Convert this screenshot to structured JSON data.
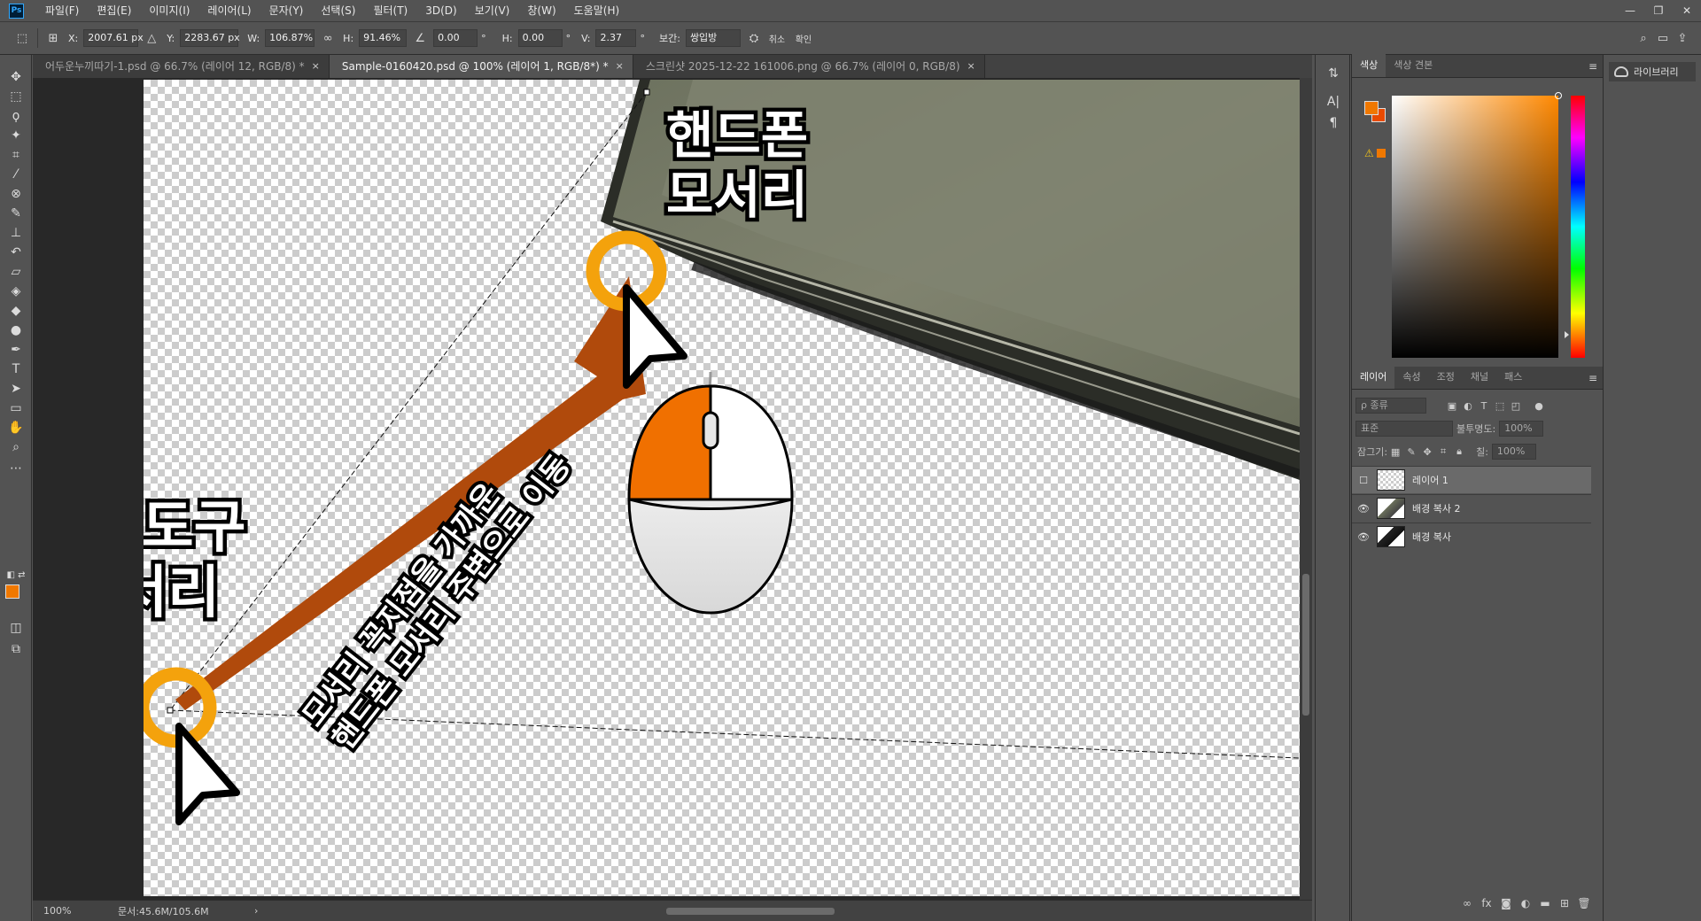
{
  "menu": {
    "items": [
      "파일(F)",
      "편집(E)",
      "이미지(I)",
      "레이어(L)",
      "문자(Y)",
      "선택(S)",
      "필터(T)",
      "3D(D)",
      "보기(V)",
      "창(W)",
      "도움말(H)"
    ],
    "window_controls": [
      "—",
      "❐",
      "✕"
    ]
  },
  "options": {
    "x_label": "X:",
    "x_value": "2007.61 px",
    "y_label": "Y:",
    "y_value": "2283.67 px",
    "w_label": "W:",
    "w_value": "106.87%",
    "h_label": "H:",
    "h_value": "91.46%",
    "angle_value": "0.00",
    "angle_unit": "°",
    "hskew_label": "H:",
    "hskew_value": "0.00",
    "vskew_label": "V:",
    "vskew_value": "2.37",
    "interp_label": "보간:",
    "interp_value": "쌍입방",
    "cancel_label": "취소",
    "commit_label": "확인"
  },
  "tabs": [
    {
      "label": "어두운누끼따기-1.psd @ 66.7% (레이어 12, RGB/8) *",
      "active": false
    },
    {
      "label": "Sample-0160420.psd @ 100% (레이어 1, RGB/8*) *",
      "active": true
    },
    {
      "label": "스크린샷 2025-12-22 161006.png @ 66.7% (레이어 0, RGB/8)",
      "active": false
    }
  ],
  "tab_close": "×",
  "canvas": {
    "label_phone_corner_line1": "핸드폰",
    "label_phone_corner_line2": "모서리",
    "label_transform_line1": "변형도구",
    "label_transform_line2": "모서리",
    "diag_line1": "모서리 꼭지점을 가까운",
    "diag_line2": "핸드폰 모서리 주변으로 이동",
    "arrow_color": "#b04a0c",
    "circle_color": "#f4a20c",
    "mouse_button_color": "#f07000"
  },
  "status": {
    "zoom": "100%",
    "doc_info": "문서:45.6M/105.6M",
    "arrow": "›"
  },
  "color_panel": {
    "tabs": [
      "색상",
      "색상 견본"
    ],
    "foreground": "#f07800",
    "background": "#e84a00"
  },
  "layers_panel": {
    "tabs": [
      "레이어",
      "속성",
      "조정",
      "채널",
      "패스"
    ],
    "filter_label": "ρ 종류",
    "blend_mode": "표준",
    "opacity_label": "불투명도:",
    "opacity_value": "100%",
    "lock_label": "잠그기:",
    "fill_label": "칠:",
    "fill_value": "100%",
    "layers": [
      {
        "name": "레이어 1",
        "visible": false,
        "selected": true
      },
      {
        "name": "배경 복사 2",
        "visible": true,
        "selected": false
      },
      {
        "name": "배경 복사",
        "visible": true,
        "selected": false
      }
    ],
    "footer_icons": [
      "link-icon",
      "fx-icon",
      "mask-icon",
      "adjustment-icon",
      "folder-icon",
      "new-layer-icon",
      "trash-icon"
    ]
  },
  "library": {
    "label": "라이브러리"
  }
}
